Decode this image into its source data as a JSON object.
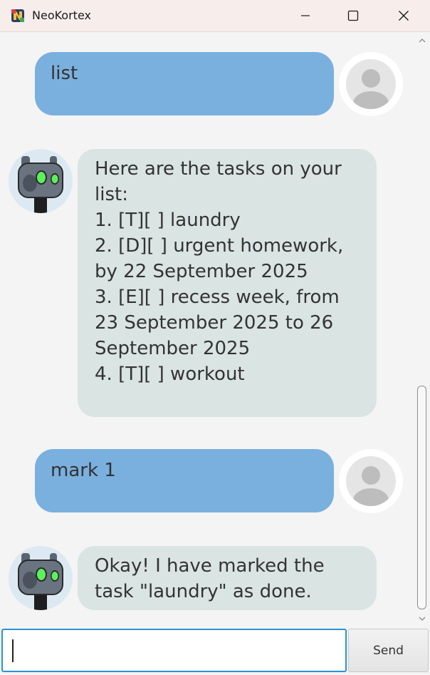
{
  "window": {
    "title": "NeoKortex",
    "app_icon": "neokortex-app-icon"
  },
  "messages": [
    {
      "sender": "user",
      "text": "list",
      "avatar": "user-avatar-icon"
    },
    {
      "sender": "bot",
      "text": "Here are the tasks on your list:\n1. [T][ ] laundry\n2. [D][ ] urgent homework, by 22 September 2025\n3. [E][ ] recess week, from 23 September 2025 to 26 September 2025\n4. [T][ ] workout",
      "avatar": "robot-avatar-icon"
    },
    {
      "sender": "user",
      "text": "mark 1",
      "avatar": "user-avatar-icon"
    },
    {
      "sender": "bot",
      "text": "Okay! I have marked the task \"laundry\" as done.",
      "avatar": "robot-avatar-icon"
    }
  ],
  "input": {
    "value": "",
    "placeholder": ""
  },
  "send_button": {
    "label": "Send"
  },
  "colors": {
    "user_bubble": "#7ab0de",
    "bot_bubble": "#dae4e2",
    "input_focus": "#2a92d6",
    "background": "#f4f4f4"
  }
}
